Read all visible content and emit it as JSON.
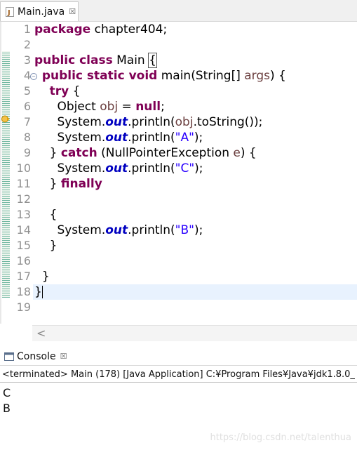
{
  "editor": {
    "tab_label": "Main.java",
    "close_glyph": "☒",
    "line_numbers": [
      "1",
      "2",
      "3",
      "4",
      "5",
      "6",
      "7",
      "8",
      "9",
      "10",
      "11",
      "12",
      "13",
      "14",
      "15",
      "16",
      "17",
      "18",
      "19"
    ],
    "code": {
      "l1": {
        "kw": "package",
        "text": " chapter404;"
      },
      "l3": {
        "kw": "public class",
        "text": " Main ",
        "brace": "{"
      },
      "l4": {
        "kw1": "public static void",
        "text": " main(String[] ",
        "var": "args",
        "tail": ") {"
      },
      "l5": {
        "kw": "try",
        "tail": " {"
      },
      "l6": {
        "pre": "Object ",
        "var": "obj",
        "mid": " = ",
        "kw": "null",
        "tail": ";"
      },
      "l7": {
        "pre": "System.",
        "fld": "out",
        "mid": ".println(",
        "var": "obj",
        "tail": ".toString());"
      },
      "l8": {
        "pre": "System.",
        "fld": "out",
        "mid": ".println(",
        "str": "\"A\"",
        "tail": ");"
      },
      "l9": {
        "pre": "} ",
        "kw": "catch",
        "mid": " (NullPointerException ",
        "var": "e",
        "tail": ") {"
      },
      "l10": {
        "pre": "System.",
        "fld": "out",
        "mid": ".println(",
        "str": "\"C\"",
        "tail": ");"
      },
      "l11": {
        "pre": "} ",
        "kw": "finally"
      },
      "l13": {
        "text": "{"
      },
      "l14": {
        "pre": "System.",
        "fld": "out",
        "mid": ".println(",
        "str": "\"B\"",
        "tail": ");"
      },
      "l15": {
        "text": "}"
      },
      "l17": {
        "text": "}"
      },
      "l18": {
        "text": "}"
      }
    },
    "scroll_left_glyph": "<"
  },
  "console": {
    "tab_label": "Console",
    "close_glyph": "☒",
    "status": "<terminated> Main (178) [Java Application] C:¥Program Files¥Java¥jdk1.8.0_",
    "output": [
      "C",
      "B"
    ]
  },
  "watermark": "https://blog.csdn.net/talenthua",
  "colors": {
    "keyword": "#7f0055",
    "field": "#0000c0",
    "variable": "#6a3e3e",
    "string": "#2a00ff",
    "current_line": "#e8f2fe"
  }
}
